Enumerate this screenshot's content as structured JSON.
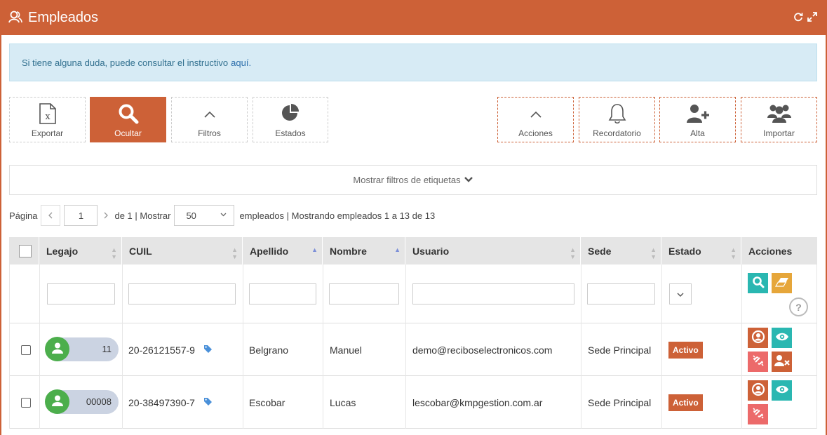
{
  "header": {
    "title": "Empleados"
  },
  "info": {
    "text": "Si tiene alguna duda, puede consultar el instructivo",
    "link": "aquí."
  },
  "toolbar": {
    "exportar": "Exportar",
    "ocultar": "Ocultar",
    "filtros": "Filtros",
    "estados": "Estados",
    "acciones": "Acciones",
    "recordatorio": "Recordatorio",
    "alta": "Alta",
    "importar": "Importar"
  },
  "tag_filters": {
    "label": "Mostrar filtros de etiquetas"
  },
  "pager": {
    "page_label": "Página",
    "page": "1",
    "of_text": "de 1 | Mostrar",
    "per_page": "50",
    "summary": "empleados | Mostrando empleados 1 a 13 de 13"
  },
  "table": {
    "headers": {
      "legajo": "Legajo",
      "cuil": "CUIL",
      "apellido": "Apellido",
      "nombre": "Nombre",
      "usuario": "Usuario",
      "sede": "Sede",
      "estado": "Estado",
      "acciones": "Acciones"
    },
    "help": "?",
    "rows": [
      {
        "legajo": "11",
        "cuil": "20-26121557-9",
        "apellido": "Belgrano",
        "nombre": "Manuel",
        "usuario": "demo@reciboselectronicos.com",
        "sede": "Sede Principal",
        "estado": "Activo"
      },
      {
        "legajo": "00008",
        "cuil": "20-38497390-7",
        "apellido": "Escobar",
        "nombre": "Lucas",
        "usuario": "lescobar@kmpgestion.com.ar",
        "sede": "Sede Principal",
        "estado": "Activo"
      }
    ]
  },
  "colors": {
    "brand": "#cd6137",
    "teal": "#2ab7b1",
    "yellow": "#e6a63a",
    "pink": "#ec6a6a",
    "green": "#4cae4c"
  }
}
